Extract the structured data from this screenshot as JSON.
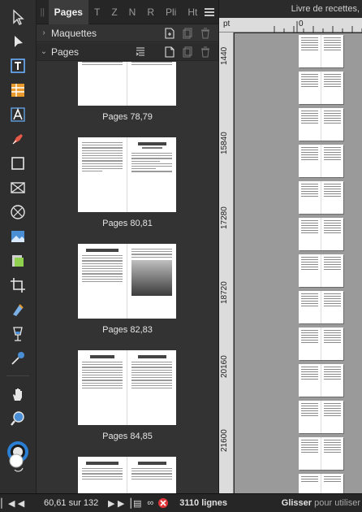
{
  "panel": {
    "tabs": [
      "Pages",
      "T",
      "Z",
      "N",
      "R",
      "Pli",
      "Ht"
    ],
    "masters_label": "Maquettes",
    "pages_label": "Pages",
    "spreads": [
      {
        "label": "Pages 78,79"
      },
      {
        "label": "Pages 80,81"
      },
      {
        "label": "Pages 82,83"
      },
      {
        "label": "Pages 84,85"
      }
    ]
  },
  "document": {
    "title": "Livre de recettes,"
  },
  "ruler": {
    "unit": "pt",
    "h_zero": "0",
    "v_labels": [
      "1440",
      "15840",
      "17280",
      "18720",
      "20160",
      "21600"
    ]
  },
  "statusbar": {
    "page_info": "60,61 sur 132",
    "lines": "3110 lignes",
    "hint_bold": "Glisser",
    "hint_rest": " pour utiliser"
  },
  "colors": {
    "accent": "#3a8ee6",
    "panel_bg": "#333333",
    "canvas_bg": "#9a9a9a"
  }
}
